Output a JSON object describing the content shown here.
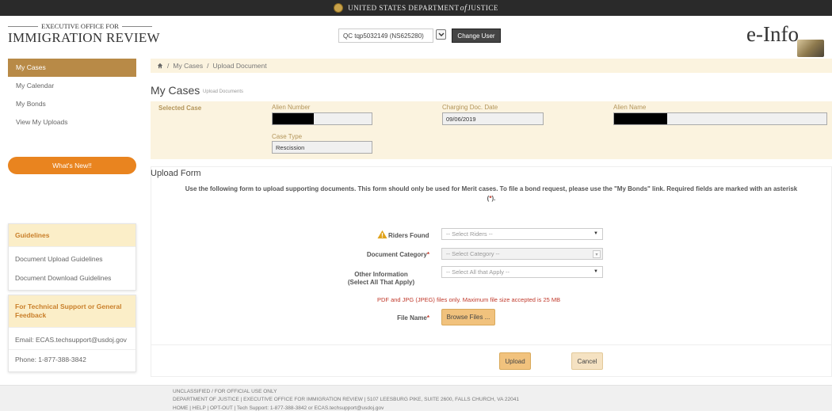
{
  "topbar": {
    "text_left": "UNITED STATES DEPARTMENT",
    "text_of": "of",
    "text_right": "JUSTICE"
  },
  "header": {
    "agency_top": "EXECUTIVE OFFICE FOR",
    "agency_bottom": "IMMIGRATION REVIEW",
    "user_selected": "QC tqp5032149 (NS625280)",
    "change_user_label": "Change User",
    "brand": "e-Info"
  },
  "sidebar": {
    "items": [
      {
        "label": "My Cases",
        "active": true
      },
      {
        "label": "My Calendar",
        "active": false
      },
      {
        "label": "My Bonds",
        "active": false
      },
      {
        "label": "View My Uploads",
        "active": false
      }
    ],
    "whats_new": "What's New!!",
    "guidelines": {
      "title": "Guidelines",
      "links": [
        "Document Upload Guidelines",
        "Document Download Guidelines"
      ]
    },
    "support": {
      "title": "For Technical Support or General Feedback",
      "email": "Email: ECAS.techsupport@usdoj.gov",
      "phone": "Phone: 1-877-388-3842"
    }
  },
  "breadcrumb": {
    "items": [
      "My Cases",
      "Upload Document"
    ],
    "separator": "/"
  },
  "page": {
    "title": "My Cases",
    "subtitle": "Upload Documents"
  },
  "case": {
    "section_label": "Selected Case",
    "alien_number_label": "Alien Number",
    "alien_number_value": "",
    "charging_date_label": "Charging Doc. Date",
    "charging_date_value": "09/06/2019",
    "alien_name_label": "Alien Name",
    "alien_name_value": "",
    "case_type_label": "Case Type",
    "case_type_value": "Rescission"
  },
  "upload_form": {
    "title": "Upload Form",
    "notice_main": "Use the following form to upload supporting documents. This form should only be used for Merit cases. To file a bond request, please use the \"My Bonds\" link. Required fields are marked with an asterisk (",
    "notice_asterisk": "*",
    "notice_end": ").",
    "riders_label": "Riders Found",
    "riders_placeholder": "-- Select Riders --",
    "category_label": "Document Category",
    "category_placeholder": "-- Select Category --",
    "other_label_line1": "Other Information",
    "other_label_line2": "(Select All That Apply)",
    "other_placeholder": "-- Select All that Apply --",
    "file_note": "PDF and JPG (JPEG) files only. Maximum file size accepted is 25 MB",
    "file_name_label": "File Name",
    "required_mark": "*",
    "browse_label": "Browse Files ...",
    "upload_label": "Upload",
    "cancel_label": "Cancel"
  },
  "footer": {
    "line1": "UNCLASSIFIED / FOR OFFICIAL USE ONLY",
    "line2": "DEPARTMENT OF JUSTICE | EXECUTIVE OFFICE FOR IMMIGRATION REVIEW | 5107 LEESBURG PIKE, SUITE 2600, FALLS CHURCH, VA 22041",
    "line3": "HOME | HELP | OPT-OUT | Tech Support: 1-877-388-3842 or ECAS.techsupport@usdoj.gov"
  },
  "colors": {
    "accent": "#b88a47",
    "orange": "#e9841f",
    "button": "#f1c27d",
    "cream": "#fbf3df",
    "required": "#c0392b"
  },
  "icons": [
    "seal-icon",
    "chevron-down-icon",
    "home-icon",
    "warning-icon"
  ]
}
